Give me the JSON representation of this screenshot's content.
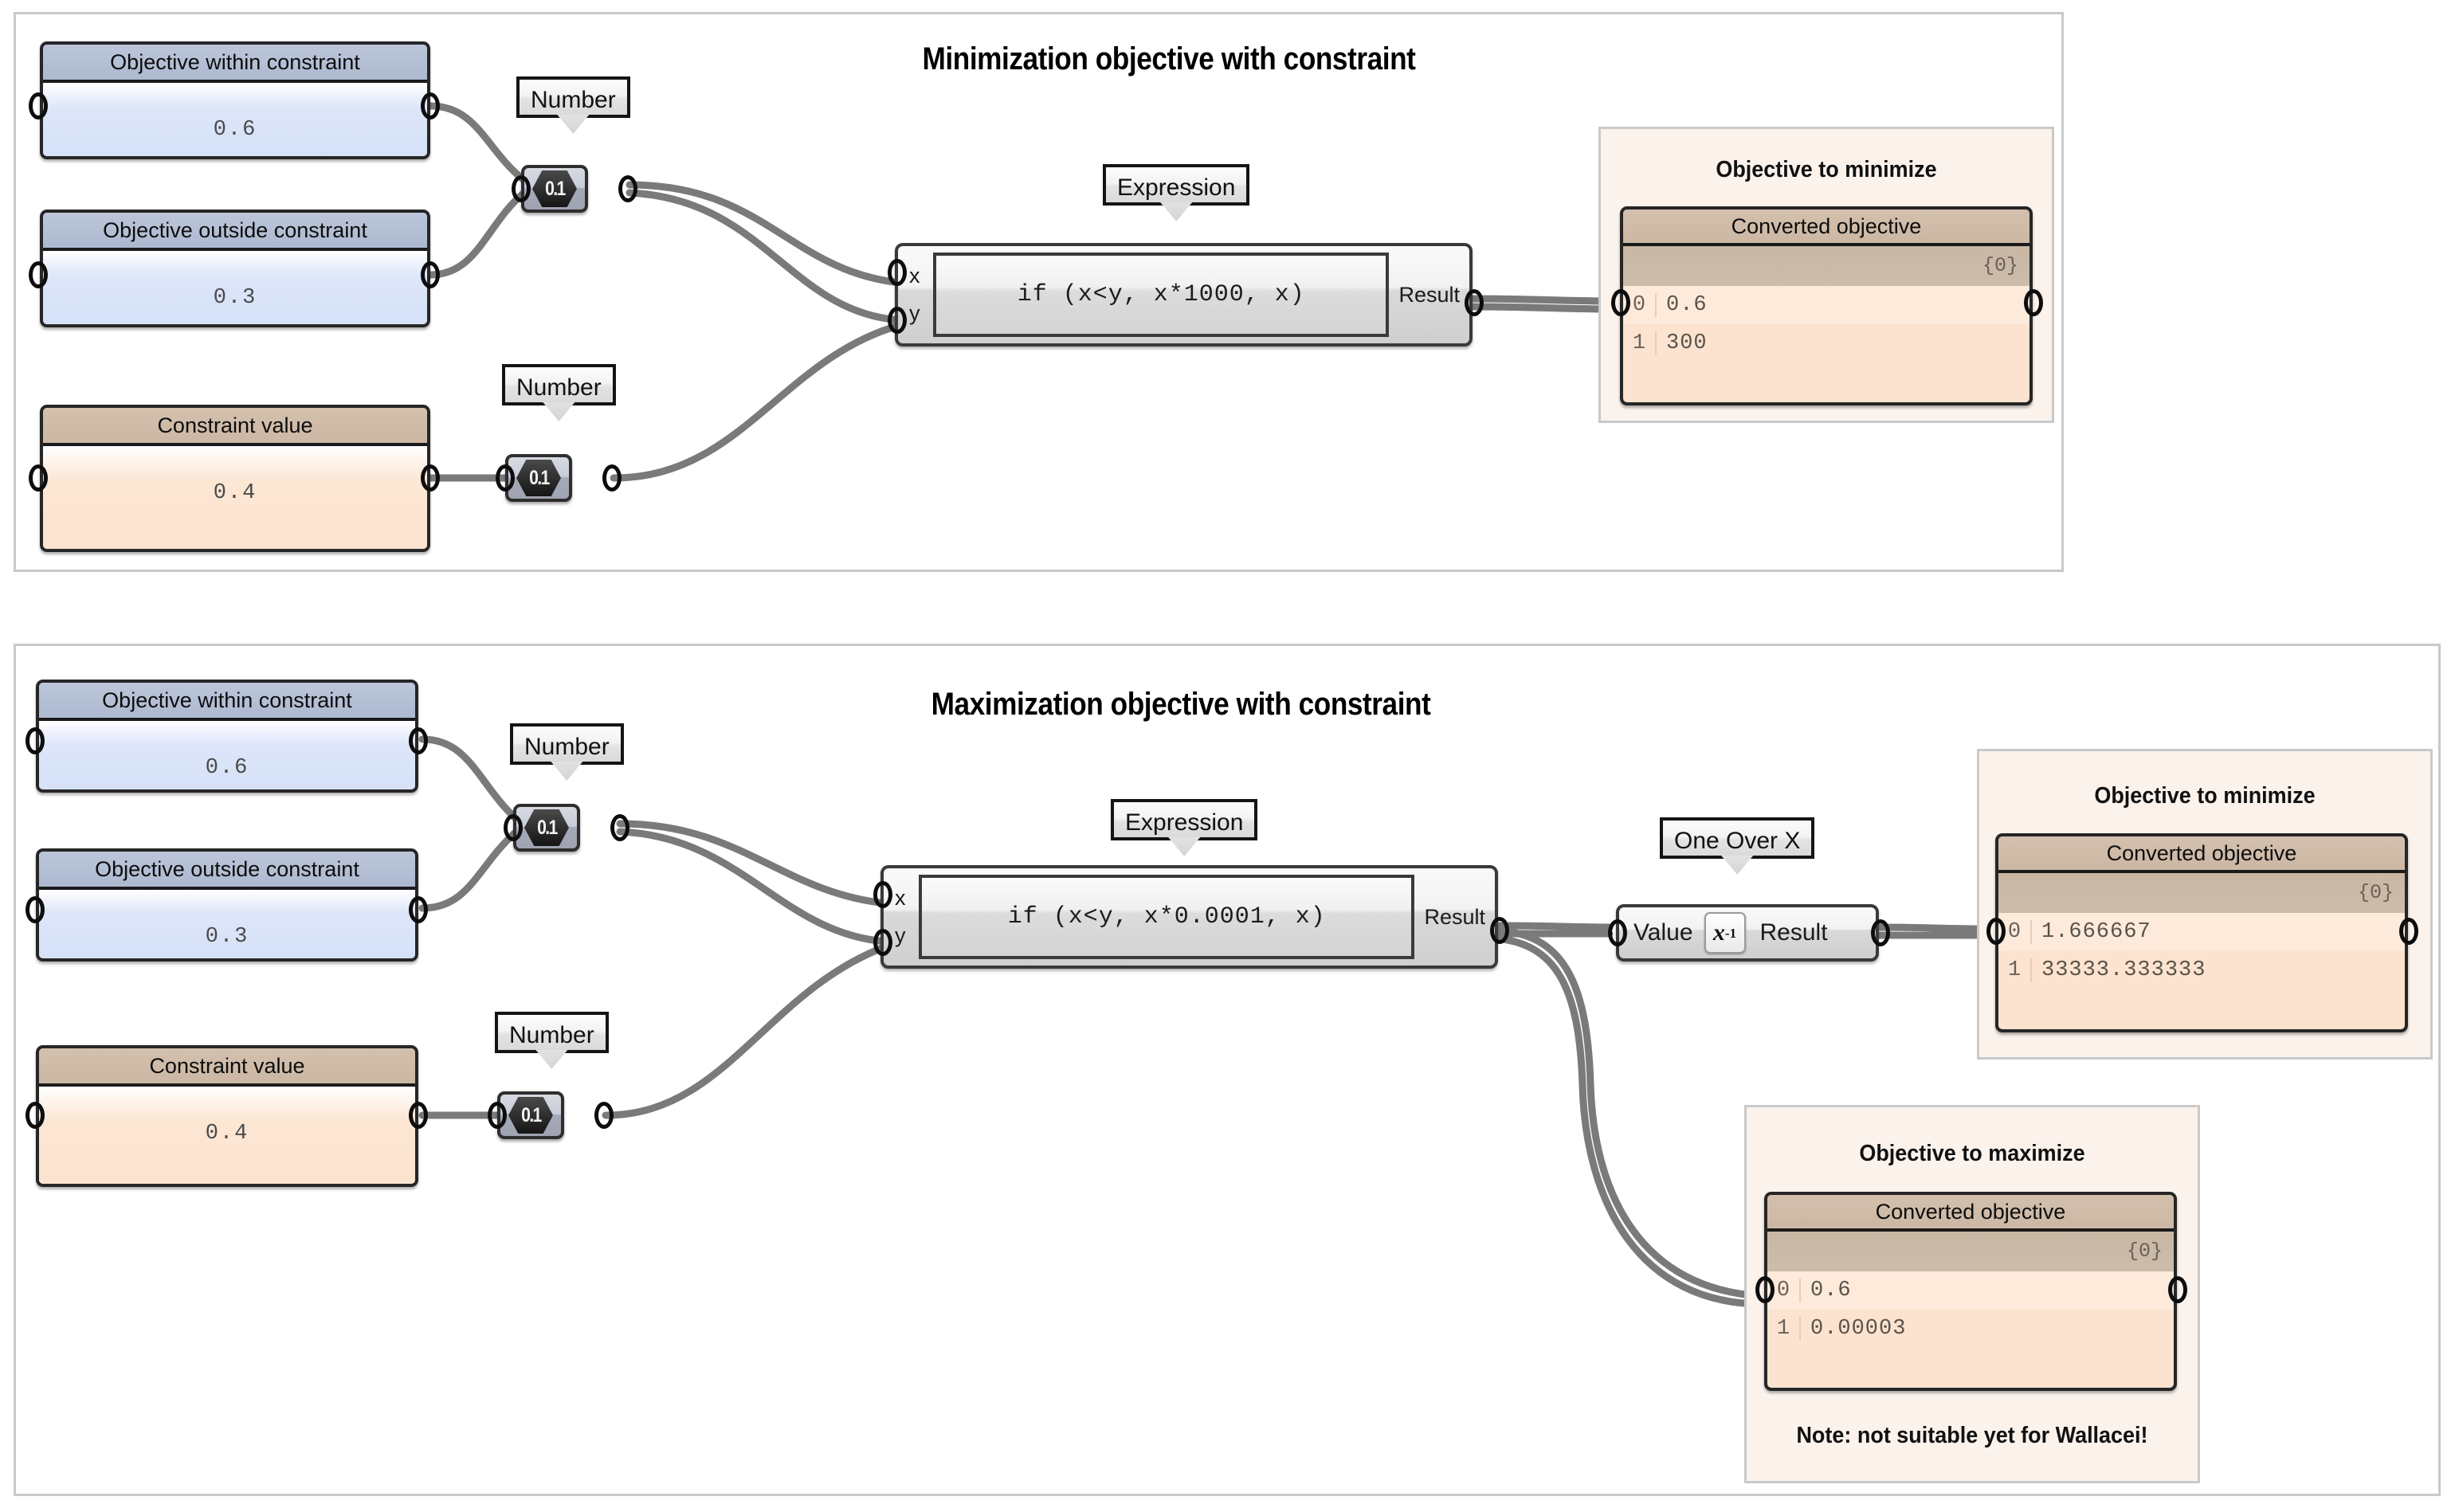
{
  "sections": [
    {
      "id": "minimization",
      "title": "Minimization objective with constraint",
      "panels": [
        {
          "id": "obj-within",
          "caption": "Objective within constraint",
          "value": "0.6"
        },
        {
          "id": "obj-outside",
          "caption": "Objective outside constraint",
          "value": "0.3"
        },
        {
          "id": "constraint",
          "caption": "Constraint value",
          "value": "0.4"
        }
      ],
      "sliders": [
        {
          "id": "num-top",
          "callout": "Number",
          "icon_value": "0.1"
        },
        {
          "id": "num-bottom",
          "callout": "Number",
          "icon_value": "0.1"
        }
      ],
      "expression": {
        "callout": "Expression",
        "input_x": "x",
        "input_y": "y",
        "formula": "if (x<y, x*1000, x)",
        "output": "Result"
      },
      "output_group": {
        "title": "Objective to minimize",
        "grid": {
          "caption": "Converted objective",
          "branch": "{0}",
          "rows": [
            {
              "index": "0",
              "value": "0.6"
            },
            {
              "index": "1",
              "value": "300"
            }
          ]
        }
      }
    },
    {
      "id": "maximization",
      "title": "Maximization objective with constraint",
      "panels": [
        {
          "id": "obj-within",
          "caption": "Objective within constraint",
          "value": "0.6"
        },
        {
          "id": "obj-outside",
          "caption": "Objective outside constraint",
          "value": "0.3"
        },
        {
          "id": "constraint",
          "caption": "Constraint value",
          "value": "0.4"
        }
      ],
      "sliders": [
        {
          "id": "num-top",
          "callout": "Number",
          "icon_value": "0.1"
        },
        {
          "id": "num-bottom",
          "callout": "Number",
          "icon_value": "0.1"
        }
      ],
      "expression": {
        "callout": "Expression",
        "input_x": "x",
        "input_y": "y",
        "formula": "if (x<y, x*0.0001, x)",
        "output": "Result"
      },
      "one_over_x": {
        "callout": "One Over X",
        "input": "Value",
        "icon": "x-inverse-icon",
        "icon_base": "x",
        "icon_exp": "-1",
        "output": "Result"
      },
      "output_groups": [
        {
          "id": "to-minimize",
          "title": "Objective to minimize",
          "grid": {
            "caption": "Converted objective",
            "branch": "{0}",
            "rows": [
              {
                "index": "0",
                "value": "1.666667"
              },
              {
                "index": "1",
                "value": "33333.333333"
              }
            ]
          }
        },
        {
          "id": "to-maximize",
          "title": "Objective to maximize",
          "note": "Note: not suitable yet for Wallacei!",
          "grid": {
            "caption": "Converted objective",
            "branch": "{0}",
            "rows": [
              {
                "index": "0",
                "value": "0.6"
              },
              {
                "index": "1",
                "value": "0.00003"
              }
            ]
          }
        }
      ]
    }
  ],
  "colors": {
    "panel_blue_cap": "#b3bed3",
    "panel_blue_body": "#d6e1f8",
    "panel_tan_cap": "#cbb7a3",
    "panel_tan_body": "#fbe3cf",
    "group_border": "#c9c9c9",
    "subgroup_bg": "#fbf2ec",
    "wire": "#7a7a7a",
    "node_border": "#262626"
  }
}
